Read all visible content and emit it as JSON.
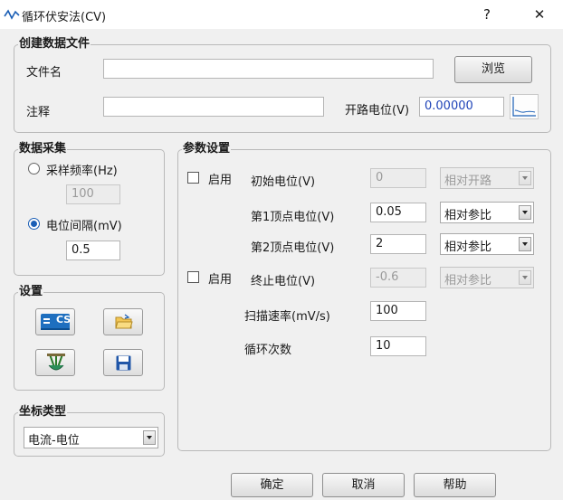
{
  "window": {
    "title": "循环伏安法(CV)",
    "help_glyph": "?",
    "close_glyph": "✕",
    "title_icon": "cv-wave-icon"
  },
  "create_file": {
    "legend": "创建数据文件",
    "filename_label": "文件名",
    "filename_value": "",
    "comment_label": "注释",
    "comment_value": "",
    "browse_label": "浏览",
    "ocp_label": "开路电位(V)",
    "ocp_value": "0.00000",
    "ocp_icon": "ocp-curve-icon"
  },
  "acquisition": {
    "legend": "数据采集",
    "sample_rate_label": "采样频率(Hz)",
    "sample_rate_value": "100",
    "sample_rate_selected": false,
    "interval_label": "电位间隔(mV)",
    "interval_value": "0.5",
    "interval_selected": true
  },
  "settings": {
    "legend": "设置",
    "icons": [
      "cs-device-icon",
      "open-folder-icon",
      "electrode-icon",
      "save-disk-icon"
    ],
    "cs_badge": "CS"
  },
  "coordinate": {
    "legend": "坐标类型",
    "value": "电流-电位"
  },
  "params": {
    "legend": "参数设置",
    "enable_label": "启用",
    "enable_initial_checked": false,
    "enable_final_checked": false,
    "initial_label": "初始电位(V)",
    "initial_value": "0",
    "initial_ref": "相对开路",
    "vertex1_label": "第1顶点电位(V)",
    "vertex1_value": "0.05",
    "vertex1_ref": "相对参比",
    "vertex2_label": "第2顶点电位(V)",
    "vertex2_value": "2",
    "vertex2_ref": "相对参比",
    "final_label": "终止电位(V)",
    "final_value": "-0.6",
    "final_ref": "相对参比",
    "scan_rate_label": "扫描速率(mV/s)",
    "scan_rate_value": "100",
    "cycles_label": "循环次数",
    "cycles_value": "10"
  },
  "footer": {
    "ok_label": "确定",
    "cancel_label": "取消",
    "help_label": "帮助"
  },
  "colors": {
    "accent": "#1b5fb6",
    "ocp_text": "#1f44b8",
    "cs_icon_bg": "#1e6fbf"
  }
}
